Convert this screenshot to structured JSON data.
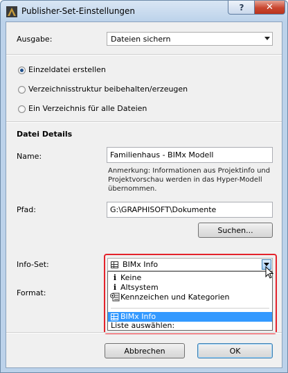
{
  "window": {
    "title": "Publisher-Set-Einstellungen",
    "help_label": "?",
    "close_label": "✕"
  },
  "ausgabe": {
    "label": "Ausgabe:",
    "value": "Dateien sichern"
  },
  "options": [
    {
      "label": "Einzeldatei erstellen",
      "checked": true
    },
    {
      "label": "Verzeichnisstruktur beibehalten/erzeugen",
      "checked": false
    },
    {
      "label": "Ein Verzeichnis für alle Dateien",
      "checked": false
    }
  ],
  "details": {
    "heading": "Datei Details",
    "name_label": "Name:",
    "name_value": "Familienhaus - BIMx Modell",
    "note_lines": [
      "Anmerkung: Informationen aus Projektinfo und",
      "Projektvorschau werden in das Hyper-Modell",
      "übernommen."
    ],
    "path_label": "Pfad:",
    "path_value": "G:\\GRAPHISOFT\\Dokumente",
    "search_label": "Suchen..."
  },
  "infoset": {
    "label": "Info-Set:",
    "value": "BIMx Info",
    "items": [
      {
        "icon": "i",
        "label": "Keine"
      },
      {
        "icon": "i",
        "label": "Altsystem"
      },
      {
        "icon": "tags",
        "label": "Kennzeichen und Kategorien"
      }
    ],
    "selected_item": "BIMx Info",
    "last_item": "Liste auswählen:"
  },
  "format": {
    "label": "Format:"
  },
  "footer": {
    "cancel_label": "Abbrechen",
    "ok_label": "OK"
  }
}
